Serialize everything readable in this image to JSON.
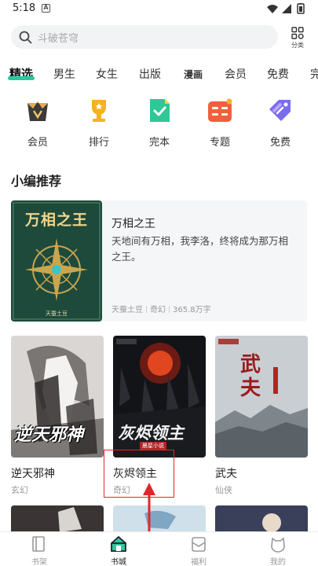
{
  "status_bar": {
    "time": "5:18",
    "a_glyph": "A"
  },
  "search": {
    "placeholder": "斗破苍穹",
    "category_label": "分类"
  },
  "tabs": [
    {
      "label": "精选"
    },
    {
      "label": "男生"
    },
    {
      "label": "女生"
    },
    {
      "label": "出版"
    },
    {
      "label": "漫画"
    },
    {
      "label": "会员"
    },
    {
      "label": "免费"
    },
    {
      "label": "完"
    }
  ],
  "quick_links": [
    {
      "label": "会员",
      "icon": "vip-crown-icon",
      "color": "#3b3b3b"
    },
    {
      "label": "排行",
      "icon": "trophy-icon",
      "color": "#f4b320"
    },
    {
      "label": "完本",
      "icon": "completed-check-icon",
      "color": "#2fc796"
    },
    {
      "label": "专题",
      "icon": "topic-grid-icon",
      "color": "#f0603c"
    },
    {
      "label": "免费",
      "icon": "free-tag-icon",
      "color": "#7b6bf0"
    }
  ],
  "section_title": "小编推荐",
  "featured": {
    "title": "万相之王",
    "description": "天地间有万相，我李洛，终将成为那万相之王。",
    "author": "天蚕土豆",
    "genre": "奇幻",
    "words": "365.8万字",
    "cover_title": "万相之王",
    "cover_author": "天蚕土豆"
  },
  "books": [
    {
      "title": "逆天邪神",
      "genre": "玄幻",
      "cover_text": "逆天邪神"
    },
    {
      "title": "灰烬领主",
      "genre": "奇幻",
      "cover_text": "灰烬领主",
      "cover_sub": "晨星小说"
    },
    {
      "title": "武夫",
      "genre": "仙侠",
      "cover_text": "武夫"
    }
  ],
  "bottom_nav": [
    {
      "label": "书架",
      "icon": "bookshelf-icon"
    },
    {
      "label": "书城",
      "icon": "bookstore-home-icon",
      "active": true
    },
    {
      "label": "福利",
      "icon": "welfare-envelope-icon"
    },
    {
      "label": "我的",
      "icon": "profile-bear-icon"
    }
  ],
  "colors": {
    "accent": "#2fc7a0",
    "annotation": "#e0262a"
  }
}
